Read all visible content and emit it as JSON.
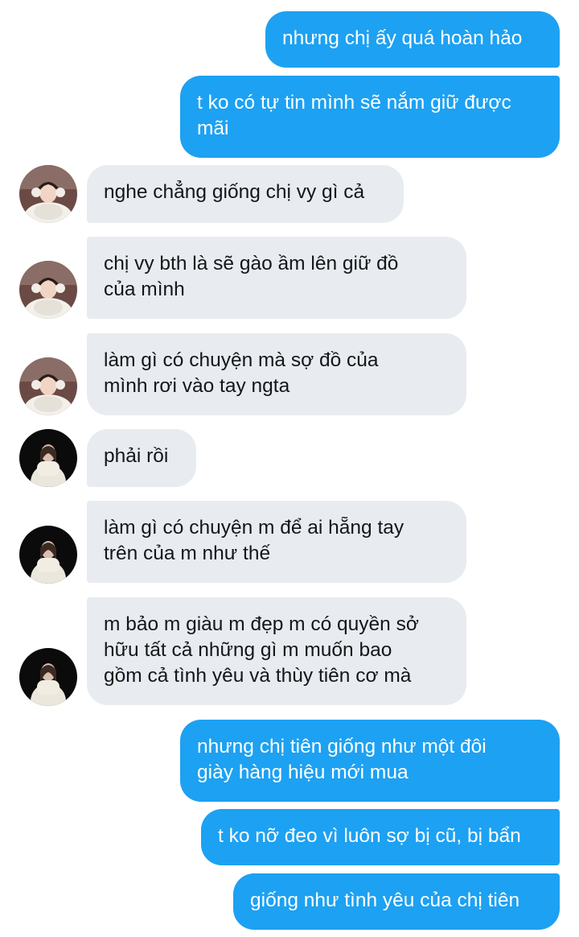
{
  "colors": {
    "sent_bubble": "#1da1f2",
    "received_bubble": "#e8ecf0",
    "sent_text": "#ffffff",
    "received_text": "#14171a"
  },
  "messages": [
    {
      "side": "sent",
      "lines": [
        "nhưng chị ấy quá hoàn hảo"
      ]
    },
    {
      "side": "sent",
      "lines": [
        "t ko có tự tin mình sẽ nắm giữ được",
        "mãi"
      ]
    },
    {
      "side": "received",
      "avatar": "avatar-girl-pink-icon",
      "lines": [
        "nghe chẳng giống chị vy gì cả"
      ]
    },
    {
      "side": "received",
      "avatar": "avatar-girl-pink-icon",
      "lines": [
        "chị vy bth là sẽ gào ầm lên giữ đồ",
        "của mình"
      ]
    },
    {
      "side": "received",
      "avatar": "avatar-girl-pink-icon",
      "lines": [
        "làm gì có chuyện mà sợ đồ của",
        "mình rơi vào tay ngta"
      ]
    },
    {
      "side": "received",
      "avatar": "avatar-girl-dark-icon",
      "lines": [
        "phải rồi"
      ]
    },
    {
      "side": "received",
      "avatar": "avatar-girl-dark-icon",
      "lines": [
        "làm gì có chuyện m để ai hẵng tay",
        "trên của m như thế"
      ]
    },
    {
      "side": "received",
      "avatar": "avatar-girl-dark-icon",
      "lines": [
        "m bảo m giàu m đẹp m có quyền sở",
        "hữu tất cả những gì m muốn bao",
        "gồm cả tình yêu và thùy tiên cơ mà"
      ]
    },
    {
      "side": "sent",
      "lines": [
        "nhưng chị tiên giống như một đôi",
        "giày hàng hiệu mới mua"
      ]
    },
    {
      "side": "sent",
      "lines": [
        "t ko nỡ đeo vì luôn sợ bị cũ, bị bẩn"
      ]
    },
    {
      "side": "sent",
      "lines": [
        "giống như tình yêu của chị tiên"
      ]
    }
  ]
}
